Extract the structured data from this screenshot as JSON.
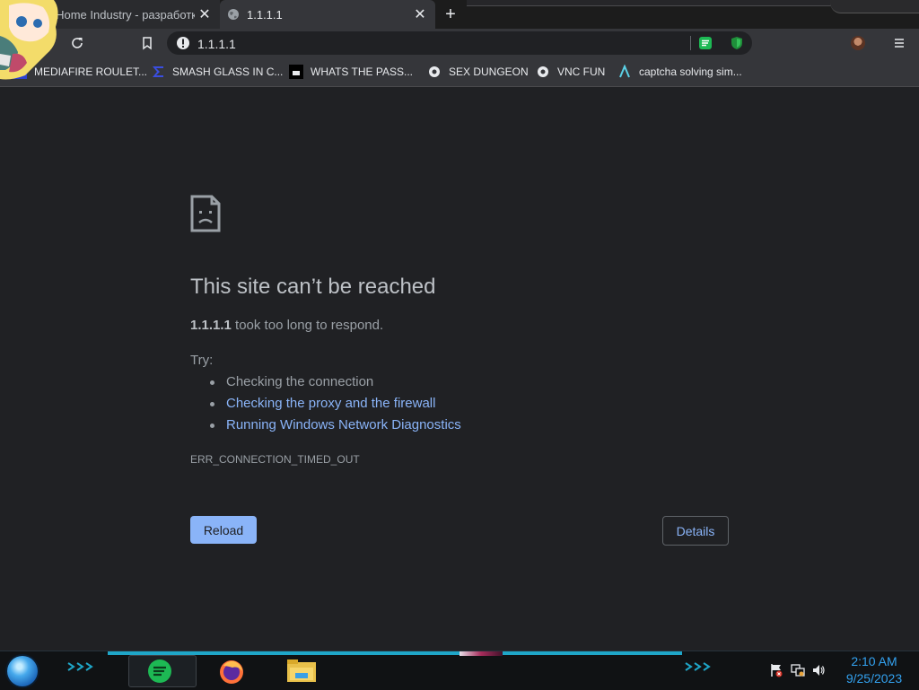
{
  "browser": {
    "tabs": [
      {
        "title": "x Home Industry - разработк",
        "active": false,
        "icon": "anime-avatar-icon"
      },
      {
        "title": "1.1.1.1",
        "active": true,
        "icon": "globe-icon"
      }
    ],
    "address": {
      "url": "1.1.1.1",
      "security_icon": "info-icon"
    },
    "extensions": [
      "spotify-ext-icon",
      "shield-ext-icon"
    ],
    "bookmarks": [
      {
        "label": "MEDIAFIRE ROULET...",
        "icon": "mediafire-icon"
      },
      {
        "label": "SMASH GLASS IN C...",
        "icon": "sigma-icon"
      },
      {
        "label": "WHATS THE PASS...",
        "icon": "dark-square-icon"
      },
      {
        "label": "SEX DUNGEON",
        "icon": "gear-site-icon"
      },
      {
        "label": "VNC FUN",
        "icon": "gear-site-icon"
      },
      {
        "label": "captcha solving sim...",
        "icon": "lambda-icon"
      }
    ]
  },
  "error_page": {
    "icon": "sad-page-icon",
    "title": "This site can’t be reached",
    "host": "1.1.1.1",
    "summary_rest": " took too long to respond.",
    "try_label": "Try:",
    "suggestions": [
      "Checking the connection",
      "Checking the proxy and the firewall",
      "Running Windows Network Diagnostics"
    ],
    "error_code": "ERR_CONNECTION_TIMED_OUT",
    "reload_label": "Reload",
    "details_label": "Details"
  },
  "taskbar": {
    "pinned": [
      "spotify-icon",
      "firefox-icon",
      "file-explorer-icon"
    ],
    "tray": [
      "action-center-flag-icon",
      "network-icon",
      "volume-icon"
    ],
    "time": "2:10 AM",
    "date": "9/25/2023"
  },
  "colors": {
    "page_bg": "#202124",
    "link": "#8ab4f8",
    "text_primary": "#bdc1c6",
    "text_secondary": "#9aa0a6",
    "clock": "#33a2f0"
  }
}
